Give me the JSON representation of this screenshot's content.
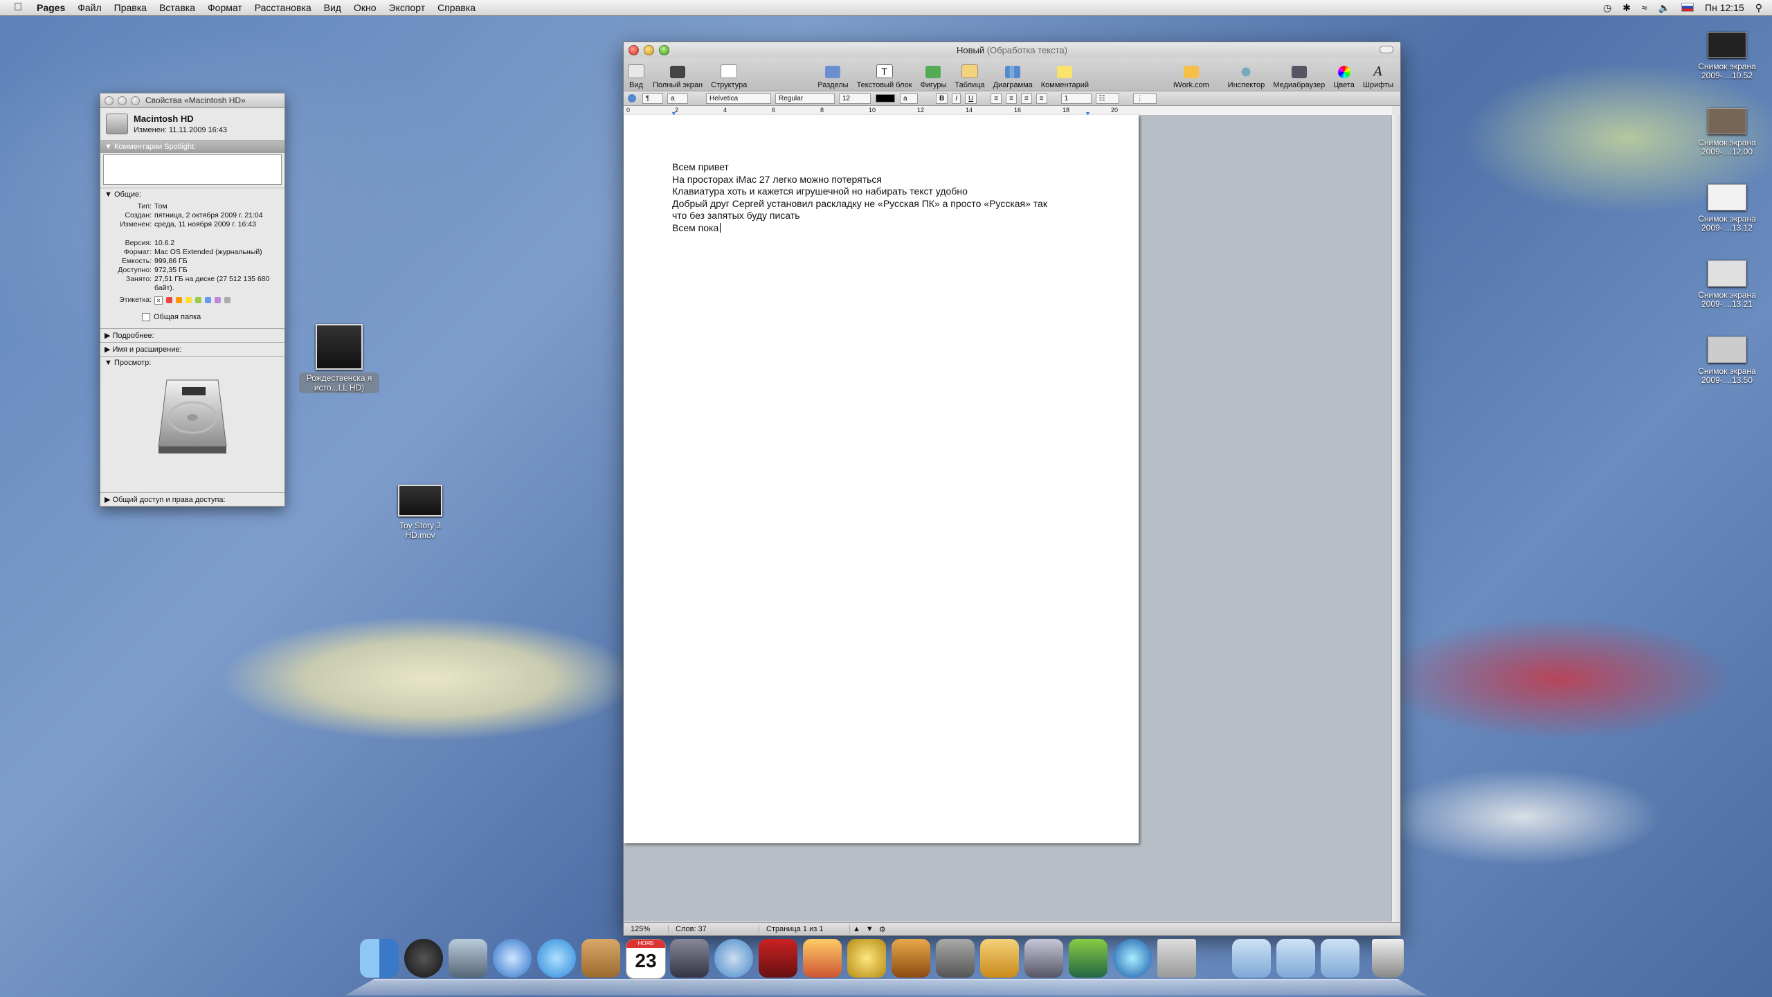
{
  "menubar": {
    "app": "Pages",
    "items": [
      "Файл",
      "Правка",
      "Вставка",
      "Формат",
      "Расстановка",
      "Вид",
      "Окно",
      "Экспорт",
      "Справка"
    ],
    "clock": "Пн 12:15"
  },
  "info_window": {
    "title": "Свойства «Macintosh HD»",
    "name": "Macintosh HD",
    "modified": "Изменен:  11.11.2009 16:43",
    "spotlight": "Комментарии Spotlight:",
    "general": "Общие:",
    "rows": [
      {
        "k": "Тип:",
        "v": "Том"
      },
      {
        "k": "Создан:",
        "v": "пятница, 2 октября 2009 г. 21:04"
      },
      {
        "k": "Изменен:",
        "v": "среда, 11 ноября 2009 г. 16:43"
      },
      {
        "k": "",
        "v": ""
      },
      {
        "k": "Версия:",
        "v": "10.6.2"
      },
      {
        "k": "Формат:",
        "v": "Mac OS Extended (журнальный)"
      },
      {
        "k": "Емкость:",
        "v": "999,86 ГБ"
      },
      {
        "k": "Доступно:",
        "v": "972,35 ГБ"
      },
      {
        "k": "Занято:",
        "v": "27,51 ГБ на диске (27 512 135 680 байт)."
      }
    ],
    "label_key": "Этикетка:",
    "label_colors": [
      "#e44",
      "#f90",
      "#fd3",
      "#9c4",
      "#69e",
      "#b8d",
      "#aaa"
    ],
    "shared": "Общая папка",
    "more": "Подробнее:",
    "name_ext": "Имя и расширение:",
    "preview": "Просмотр:",
    "sharing": "Общий доступ и права доступа:"
  },
  "desktop_icons": [
    {
      "label": "Рождественска я исто...LL HD)"
    },
    {
      "label": "Toy Story 3 HD.mov"
    }
  ],
  "pages": {
    "title": "Новый",
    "subtitle": "(Обработка текста)",
    "toolbar": [
      "Вид",
      "Полный экран",
      "Структура",
      "Разделы",
      "Текстовый блок",
      "Фигуры",
      "Таблица",
      "Диаграмма",
      "Комментарий",
      "iWork.com",
      "Инспектор",
      "Медиабраузер",
      "Цвета",
      "Шрифты"
    ],
    "font": "Helvetica",
    "style": "Regular",
    "size": "12",
    "spacing": "1",
    "bold": "B",
    "italic": "I",
    "underline": "U",
    "ruler": [
      "0",
      "2",
      "4",
      "6",
      "8",
      "10",
      "12",
      "14",
      "16",
      "18",
      "20"
    ],
    "doc_lines": [
      "Всем привет",
      "На просторах iMac 27 легко можно потеряться",
      "Клавиатура хоть и кажется игрушечной но набирать текст удобно",
      "Добрый друг Сергей установил раскладку не «Русская ПК» а просто «Русская» так",
      "что без запятых буду писать",
      "Всем пока"
    ],
    "zoom": "125%",
    "words": "Слов: 37",
    "page_info": "Страница 1 из 1"
  },
  "screenshots": [
    {
      "l1": "Снимок экрана",
      "l2": "2009-....10.52"
    },
    {
      "l1": "Снимок экрана",
      "l2": "2009-....12.00"
    },
    {
      "l1": "Снимок экрана",
      "l2": "2009-....13.12"
    },
    {
      "l1": "Снимок экрана",
      "l2": "2009-....13.21"
    },
    {
      "l1": "Снимок экрана",
      "l2": "2009-....13.50"
    }
  ],
  "dock": {
    "calendar_day": "23",
    "calendar_month": "НОЯБ"
  }
}
